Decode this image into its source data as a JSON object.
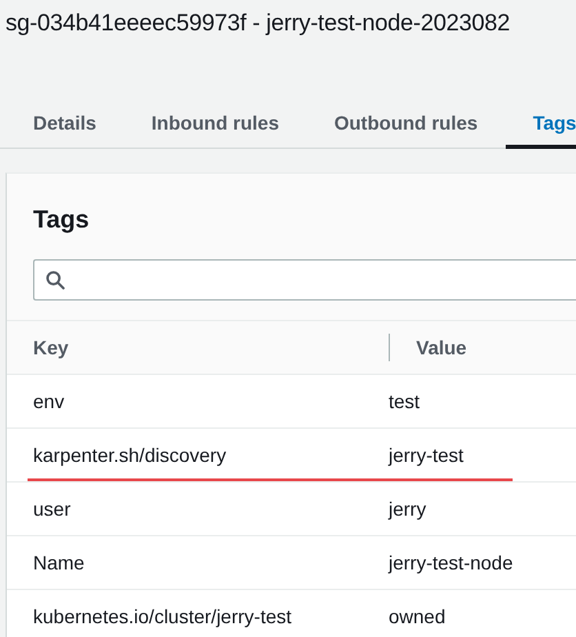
{
  "title": "sg-034b41eeeec59973f - jerry-test-node-2023082",
  "tabs": [
    {
      "label": "Details",
      "selected": false
    },
    {
      "label": "Inbound rules",
      "selected": false
    },
    {
      "label": "Outbound rules",
      "selected": false
    },
    {
      "label": "Tags",
      "selected": true
    }
  ],
  "panel": {
    "heading": "Tags"
  },
  "table": {
    "columns": [
      "Key",
      "Value"
    ],
    "rows": [
      {
        "key": "env",
        "value": "test",
        "underlined": false
      },
      {
        "key": "karpenter.sh/discovery",
        "value": "jerry-test",
        "underlined": true
      },
      {
        "key": "user",
        "value": "jerry",
        "underlined": false
      },
      {
        "key": "Name",
        "value": "jerry-test-node",
        "underlined": false
      },
      {
        "key": "kubernetes.io/cluster/jerry-test",
        "value": "owned",
        "underlined": false
      }
    ]
  }
}
